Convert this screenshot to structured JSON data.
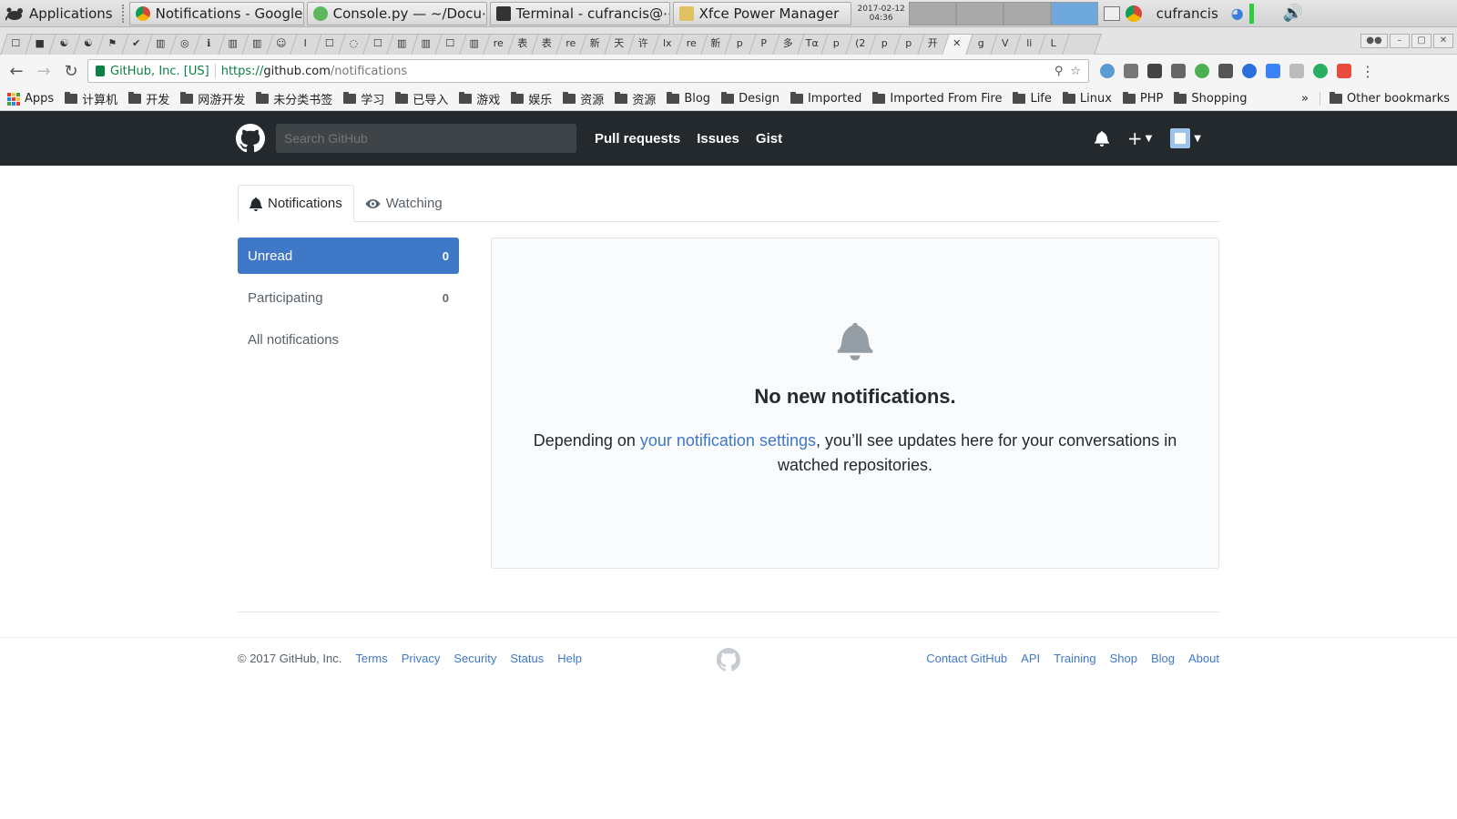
{
  "os_panel": {
    "applications_label": "Applications",
    "tasks": [
      {
        "label": "Notifications - Google ⋯"
      },
      {
        "label": "Console.py — ~/Docu⋯"
      },
      {
        "label": "Terminal - cufrancis@⋯"
      },
      {
        "label": "Xfce Power Manager"
      }
    ],
    "clock_date": "2017-02-12",
    "clock_time": "04:36",
    "username": "cufrancis"
  },
  "browser": {
    "tab_glyphs": [
      "☐",
      "■",
      "☯",
      "☯",
      "⚑",
      "✔",
      "▥",
      "◎",
      "ℹ",
      "▥",
      "▥",
      "☺",
      "I",
      "☐",
      "◌",
      "☐",
      "▥",
      "▥",
      "☐",
      "▥",
      "re",
      "表",
      "表",
      "re",
      "新",
      "天",
      "许",
      "lx",
      "re",
      "新",
      "p",
      "P",
      "多",
      "Tα",
      "p",
      "(2",
      "p",
      "p",
      "开",
      "✕",
      "g",
      "V",
      "li",
      "L"
    ],
    "address": {
      "secure_label": "GitHub, Inc. [US]",
      "scheme": "https://",
      "host": "github.com",
      "path": "/notifications"
    },
    "bookmarks": [
      {
        "label": "Apps"
      },
      {
        "label": "计算机"
      },
      {
        "label": "开发"
      },
      {
        "label": "网游开发"
      },
      {
        "label": "未分类书签"
      },
      {
        "label": "学习"
      },
      {
        "label": "已导入"
      },
      {
        "label": "游戏"
      },
      {
        "label": "娱乐"
      },
      {
        "label": "资源"
      },
      {
        "label": "资源"
      },
      {
        "label": "Blog"
      },
      {
        "label": "Design"
      },
      {
        "label": "Imported"
      },
      {
        "label": "Imported From Fire"
      },
      {
        "label": "Life"
      },
      {
        "label": "Linux"
      },
      {
        "label": "PHP"
      },
      {
        "label": "Shopping"
      }
    ],
    "bookmarks_overflow": "»",
    "other_bookmarks": "Other bookmarks"
  },
  "github": {
    "search_placeholder": "Search GitHub",
    "nav": [
      "Pull requests",
      "Issues",
      "Gist"
    ],
    "tabs": {
      "notifications": "Notifications",
      "watching": "Watching"
    },
    "filters": [
      {
        "label": "Unread",
        "count": "0"
      },
      {
        "label": "Participating",
        "count": "0"
      },
      {
        "label": "All notifications",
        "count": ""
      }
    ],
    "blankslate": {
      "title": "No new notifications.",
      "text_before": "Depending on ",
      "link": "your notification settings",
      "text_after": ", you’ll see updates here for your conversations in watched repositories."
    },
    "footer": {
      "copyright": "© 2017 GitHub, Inc.",
      "left_links": [
        "Terms",
        "Privacy",
        "Security",
        "Status",
        "Help"
      ],
      "right_links": [
        "Contact GitHub",
        "API",
        "Training",
        "Shop",
        "Blog",
        "About"
      ]
    }
  },
  "colors": {
    "header_bg": "#24292e",
    "link_blue": "#4078c8",
    "selected_filter": "#4078c8",
    "secure_green": "#0b8043"
  }
}
